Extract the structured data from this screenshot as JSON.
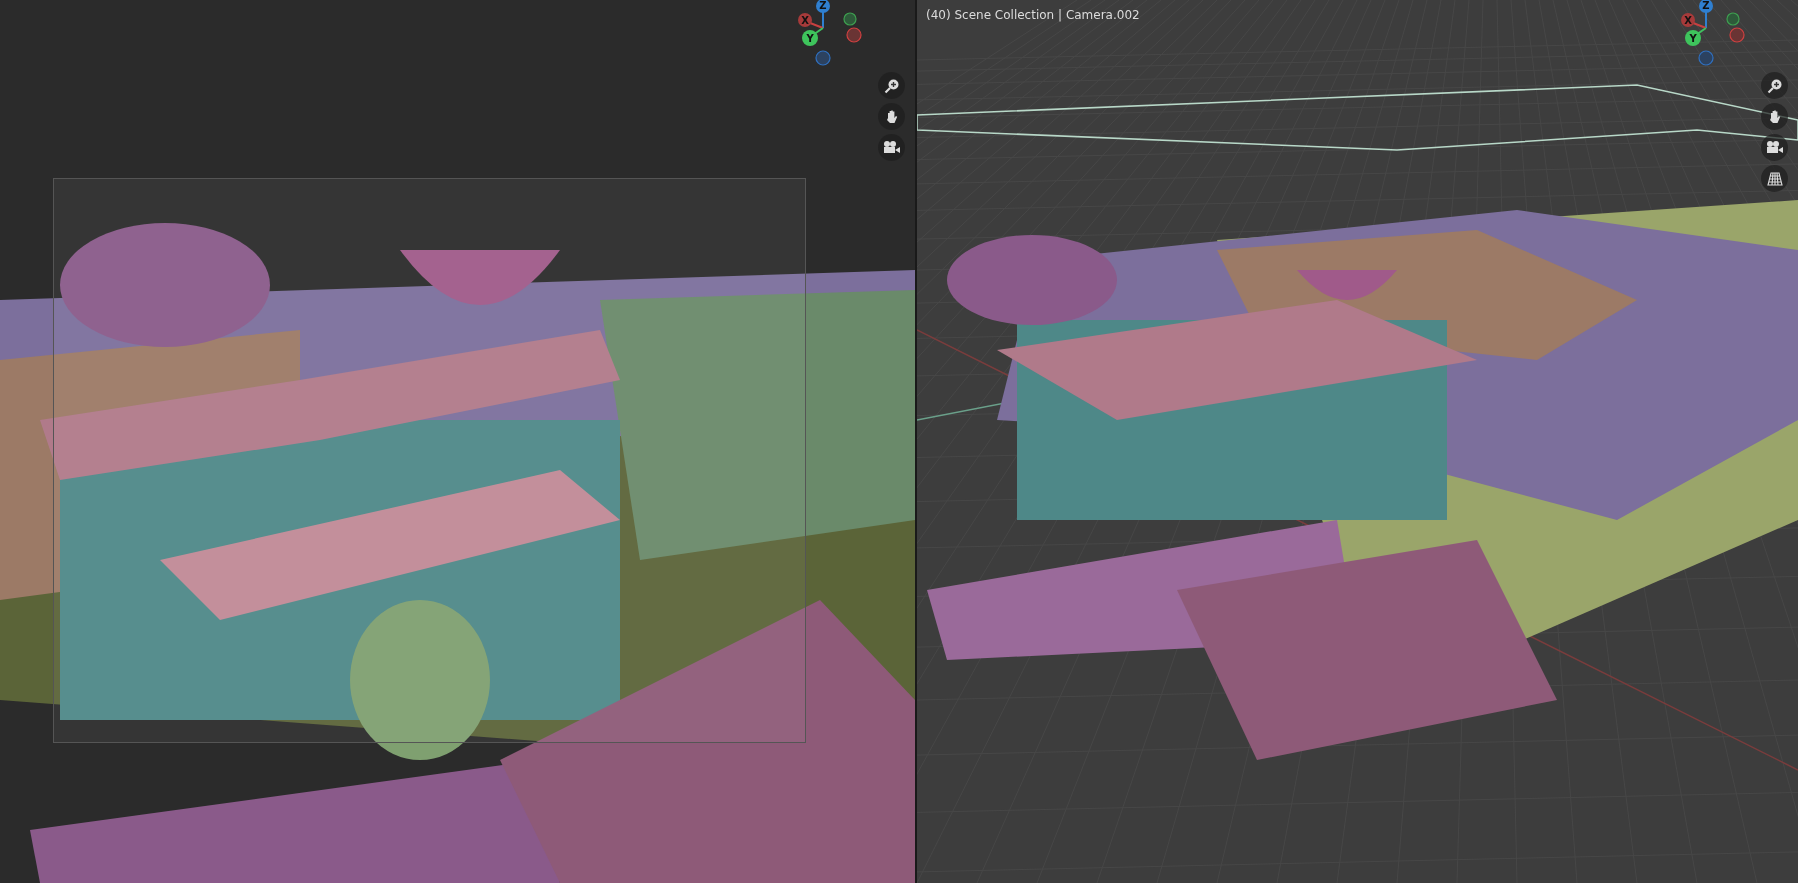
{
  "viewports": [
    {
      "kind": "camera",
      "gizmo": {
        "x": "X",
        "y": "Y",
        "z": "Z"
      },
      "nav_buttons": [
        {
          "kind": "zoom"
        },
        {
          "kind": "pan"
        },
        {
          "kind": "camera"
        }
      ]
    },
    {
      "kind": "perspective",
      "info": "(40) Scene Collection | Camera.002",
      "gizmo": {
        "x": "X",
        "y": "Y",
        "z": "Z"
      },
      "nav_buttons": [
        {
          "kind": "zoom"
        },
        {
          "kind": "pan"
        },
        {
          "kind": "camera"
        },
        {
          "kind": "grid"
        }
      ]
    }
  ]
}
